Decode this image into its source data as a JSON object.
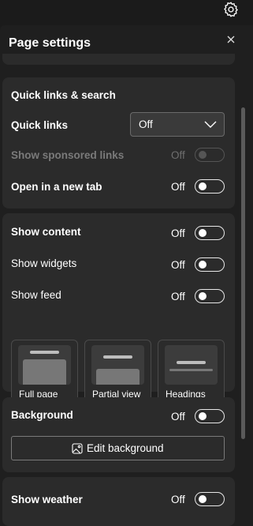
{
  "panel": {
    "title": "Page settings"
  },
  "quick_links": {
    "heading": "Quick links & search",
    "quick_links_label": "Quick links",
    "quick_links_value": "Off",
    "sponsored_label": "Show sponsored links",
    "sponsored_value": "Off",
    "new_tab_label": "Open in a new tab",
    "new_tab_value": "Off"
  },
  "content": {
    "show_content_label": "Show content",
    "show_content_value": "Off",
    "widgets_label": "Show widgets",
    "widgets_value": "Off",
    "feed_label": "Show feed",
    "feed_value": "Off",
    "layouts": [
      {
        "label": "Full page"
      },
      {
        "label": "Partial view"
      },
      {
        "label": "Headings"
      }
    ]
  },
  "background": {
    "label": "Background",
    "value": "Off",
    "edit_button": "Edit background"
  },
  "weather": {
    "label": "Show weather",
    "value": "Off"
  },
  "icons": {
    "settings": "gear-icon",
    "close": "close-icon",
    "dropdown": "chevron-down-icon",
    "edit_background": "image-icon"
  },
  "colors": {
    "panel_bg": "#1f1f1f",
    "card_bg": "#2b2b2b",
    "text": "#ffffff",
    "disabled_text": "#7a7a7a"
  }
}
